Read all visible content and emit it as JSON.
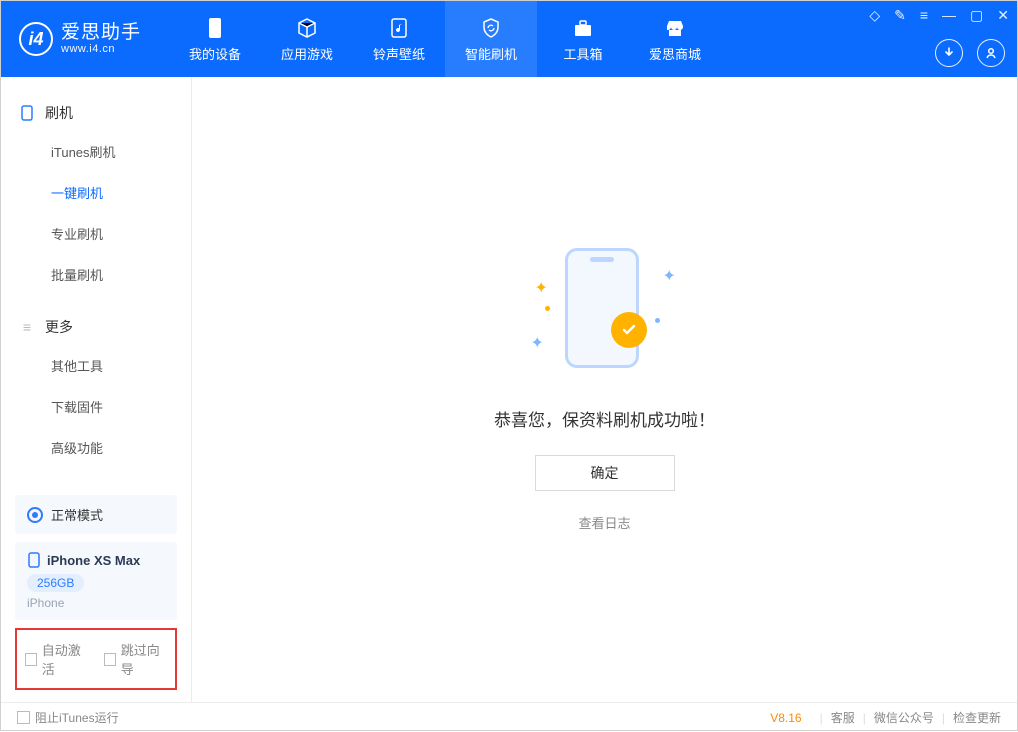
{
  "app": {
    "title": "爱思助手",
    "subtitle": "www.i4.cn"
  },
  "nav": {
    "items": [
      {
        "label": "我的设备"
      },
      {
        "label": "应用游戏"
      },
      {
        "label": "铃声壁纸"
      },
      {
        "label": "智能刷机"
      },
      {
        "label": "工具箱"
      },
      {
        "label": "爱思商城"
      }
    ]
  },
  "sidebar": {
    "group1": {
      "title": "刷机",
      "items": [
        "iTunes刷机",
        "一键刷机",
        "专业刷机",
        "批量刷机"
      ]
    },
    "group2": {
      "title": "更多",
      "items": [
        "其他工具",
        "下载固件",
        "高级功能"
      ]
    },
    "mode": "正常模式",
    "device": {
      "name": "iPhone XS Max",
      "capacity": "256GB",
      "type": "iPhone"
    },
    "options": {
      "auto_activate": "自动激活",
      "skip_guide": "跳过向导"
    }
  },
  "main": {
    "success_msg": "恭喜您，保资料刷机成功啦！",
    "ok_label": "确定",
    "view_log": "查看日志"
  },
  "footer": {
    "block_itunes": "阻止iTunes运行",
    "version": "V8.16",
    "links": [
      "客服",
      "微信公众号",
      "检查更新"
    ]
  }
}
